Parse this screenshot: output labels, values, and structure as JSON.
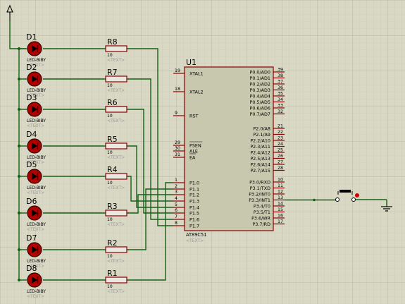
{
  "colors": {
    "background": "#d8d8c4",
    "grid_minor": "#c6c6b2",
    "grid_major": "#b2b29c",
    "wire": "#146014",
    "component_outline": "#8a0000",
    "chip_fill": "#c8c8ae",
    "led_fill": "#b00000",
    "resistor_fill": "#e8e8e0"
  },
  "power": {
    "label": ""
  },
  "mcu": {
    "ref": "U1",
    "part": "AT89C51",
    "text": "<TEXT>",
    "left_pins": [
      {
        "num": "19",
        "name": "XTAL1"
      },
      {
        "num": "18",
        "name": "XTAL2"
      },
      {
        "num": "9",
        "name": "RST"
      },
      {
        "num": "29",
        "name": "PSEN"
      },
      {
        "num": "30",
        "name": "ALE"
      },
      {
        "num": "31",
        "name": "EA"
      },
      {
        "num": "1",
        "name": "P1.0"
      },
      {
        "num": "2",
        "name": "P1.1"
      },
      {
        "num": "3",
        "name": "P1.2"
      },
      {
        "num": "4",
        "name": "P1.3"
      },
      {
        "num": "5",
        "name": "P1.4"
      },
      {
        "num": "6",
        "name": "P1.5"
      },
      {
        "num": "7",
        "name": "P1.6"
      },
      {
        "num": "8",
        "name": "P1.7"
      }
    ],
    "right_pins": [
      {
        "num": "39",
        "name": "P0.0/AD0"
      },
      {
        "num": "38",
        "name": "P0.1/AD1"
      },
      {
        "num": "37",
        "name": "P0.2/AD2"
      },
      {
        "num": "36",
        "name": "P0.3/AD3"
      },
      {
        "num": "35",
        "name": "P0.4/AD4"
      },
      {
        "num": "34",
        "name": "P0.5/AD5"
      },
      {
        "num": "33",
        "name": "P0.6/AD6"
      },
      {
        "num": "32",
        "name": "P0.7/AD7"
      },
      {
        "num": "21",
        "name": "P2.0/A8"
      },
      {
        "num": "22",
        "name": "P2.1/A9"
      },
      {
        "num": "23",
        "name": "P2.2/A10"
      },
      {
        "num": "24",
        "name": "P2.3/A11"
      },
      {
        "num": "25",
        "name": "P2.4/A12"
      },
      {
        "num": "26",
        "name": "P2.5/A13"
      },
      {
        "num": "27",
        "name": "P2.6/A14"
      },
      {
        "num": "28",
        "name": "P2.7/A15"
      },
      {
        "num": "10",
        "name": "P3.0/RXD"
      },
      {
        "num": "11",
        "name": "P3.1/TXD"
      },
      {
        "num": "12",
        "name": "P3.2/INT0"
      },
      {
        "num": "13",
        "name": "P3.3/INT1"
      },
      {
        "num": "14",
        "name": "P3.4/T0"
      },
      {
        "num": "15",
        "name": "P3.5/T1"
      },
      {
        "num": "16",
        "name": "P3.6/WR"
      },
      {
        "num": "17",
        "name": "P3.7/RD"
      }
    ]
  },
  "leds": [
    {
      "ref": "D1",
      "part": "LED-BIBY",
      "text": "<TEXT>"
    },
    {
      "ref": "D2",
      "part": "LED-BIBY",
      "text": "<TEXT>"
    },
    {
      "ref": "D3",
      "part": "LED-BIBY",
      "text": "<TEXT>"
    },
    {
      "ref": "D4",
      "part": "LED-BIBY",
      "text": "<TEXT>"
    },
    {
      "ref": "D5",
      "part": "LED-BIBY",
      "text": "<TEXT>"
    },
    {
      "ref": "D6",
      "part": "LED-BIBY",
      "text": "<TEXT>"
    },
    {
      "ref": "D7",
      "part": "LED-BIBY",
      "text": "<TEXT>"
    },
    {
      "ref": "D8",
      "part": "LED-BIBY",
      "text": "<TEXT>"
    }
  ],
  "resistors": [
    {
      "ref": "R8",
      "value": "10",
      "text": "<TEXT>"
    },
    {
      "ref": "R7",
      "value": "10",
      "text": "<TEXT>"
    },
    {
      "ref": "R6",
      "value": "10",
      "text": "<TEXT>"
    },
    {
      "ref": "R5",
      "value": "10",
      "text": "<TEXT>"
    },
    {
      "ref": "R4",
      "value": "10",
      "text": "<TEXT>"
    },
    {
      "ref": "R3",
      "value": "10",
      "text": "<TEXT>"
    },
    {
      "ref": "R2",
      "value": "10",
      "text": "<TEXT>"
    },
    {
      "ref": "R1",
      "value": "10",
      "text": "<TEXT>"
    }
  ],
  "led_to_port_pin": [
    "P1.7",
    "P1.6",
    "P1.5",
    "P1.4",
    "P1.3",
    "P1.2",
    "P1.1",
    "P1.0"
  ],
  "button": {
    "connects_to_pin": "P3.3/INT1"
  }
}
